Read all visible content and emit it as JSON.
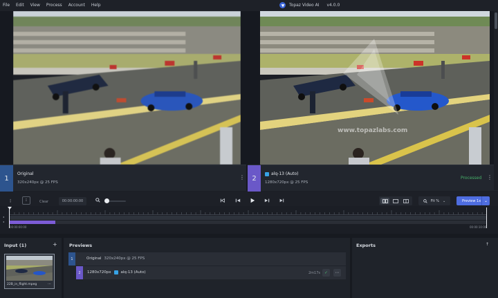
{
  "menu": [
    "File",
    "Edit",
    "View",
    "Process",
    "Account",
    "Help"
  ],
  "app": {
    "title": "Topaz Video AI",
    "version": "v4.0.0"
  },
  "viewer": {
    "watermark": "www.topazlabs.com",
    "left": {
      "number": "1",
      "name": "Original",
      "meta": "320x240px @ 25 FPS"
    },
    "right": {
      "number": "2",
      "name": "alq-13 (Auto)",
      "meta": "1280x720px @ 25 FPS",
      "status": "Processed"
    }
  },
  "transport": {
    "clear_label": "Clear",
    "timecode": "00:00:00:00",
    "zoom_level": 0.1,
    "fit_label": "Fit %",
    "preview_label": "Preview 1x"
  },
  "timeline": {
    "start_time": "00:00:00:00",
    "end_time": "00:00:10:00",
    "preview_fraction": 0.096
  },
  "input": {
    "title": "Input (1)",
    "file_name": "22B_in_flight.mpeg"
  },
  "previews": {
    "title": "Previews",
    "rows": [
      {
        "number": "1",
        "name": "Original",
        "meta": "320x240px @ 25 FPS"
      },
      {
        "number": "2",
        "resolution": "1280x720px",
        "model": "alq-13 (Auto)",
        "time": "2m17s"
      }
    ]
  },
  "exports": {
    "title": "Exports"
  },
  "colors": {
    "accent": "#4e6de0",
    "original": "#2d548e",
    "processed": "#6a58c8",
    "success": "#48b36b"
  }
}
